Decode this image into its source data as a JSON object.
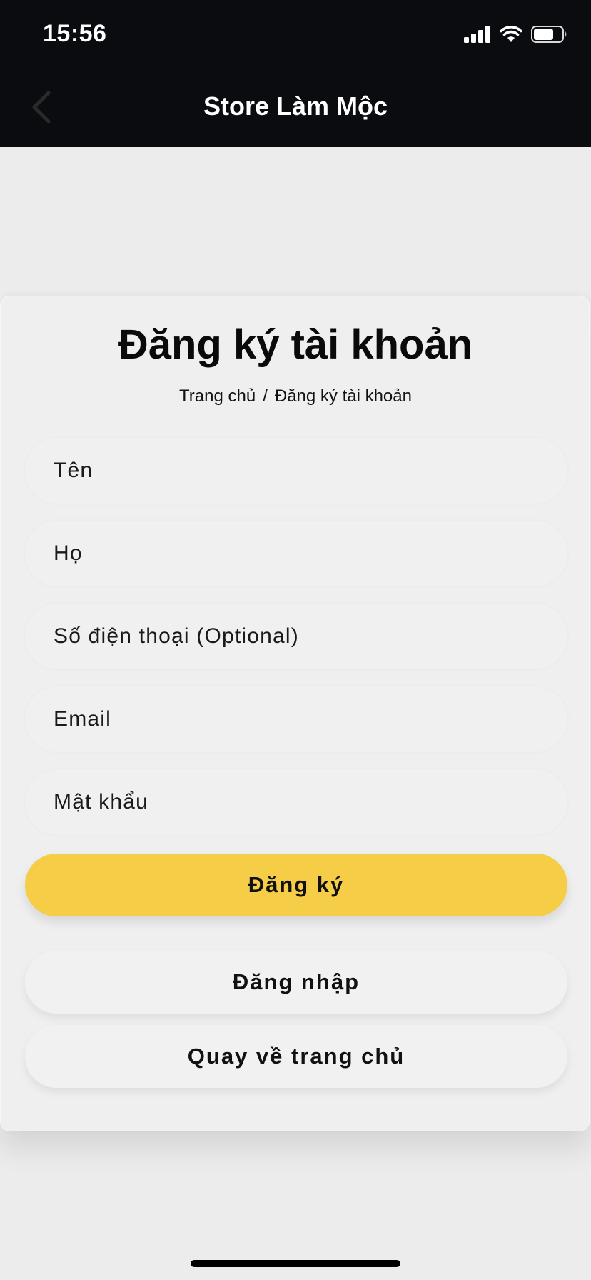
{
  "status_bar": {
    "time": "15:56"
  },
  "header": {
    "title": "Store Làm Mộc",
    "back_icon": "chevron-left-icon"
  },
  "page": {
    "title": "Đăng ký tài khoản",
    "breadcrumb": {
      "home": "Trang chủ",
      "separator": "/",
      "current": "Đăng ký tài khoản"
    }
  },
  "form": {
    "fields": [
      {
        "name": "first-name-field",
        "placeholder": "Tên",
        "value": ""
      },
      {
        "name": "last-name-field",
        "placeholder": "Họ",
        "value": ""
      },
      {
        "name": "phone-field",
        "placeholder": "Số điện thoại (Optional)",
        "value": ""
      },
      {
        "name": "email-field",
        "placeholder": "Email",
        "value": ""
      },
      {
        "name": "password-field",
        "placeholder": "Mật khẩu",
        "value": ""
      }
    ],
    "register_label": "Đăng ký",
    "login_label": "Đăng nhập",
    "home_label": "Quay về trang chủ"
  },
  "colors": {
    "header_bg": "#0b0c10",
    "primary": "#f5cd46",
    "page_bg": "#ececec"
  }
}
